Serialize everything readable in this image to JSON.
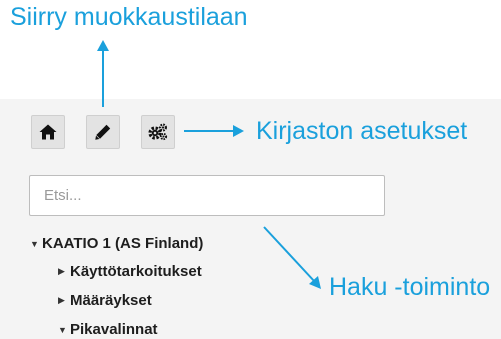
{
  "annotations": {
    "edit_mode": "Siirry muokkaustilaan",
    "library_settings": "Kirjaston asetukset",
    "search_function": "Haku -toiminto",
    "color": "#1aa0dc"
  },
  "toolbar": {
    "home_icon": "home-icon",
    "edit_icon": "pencil-icon",
    "settings_icon": "gears-icon"
  },
  "search": {
    "placeholder": "Etsi...",
    "value": ""
  },
  "tree": {
    "root": {
      "label": "KAATIO 1 (AS Finland)",
      "expanded": true
    },
    "children": [
      {
        "label": "Käyttötarkoitukset",
        "expanded": false
      },
      {
        "label": "Määräykset",
        "expanded": false
      },
      {
        "label": "Pikavalinnat",
        "expanded": true
      }
    ]
  }
}
